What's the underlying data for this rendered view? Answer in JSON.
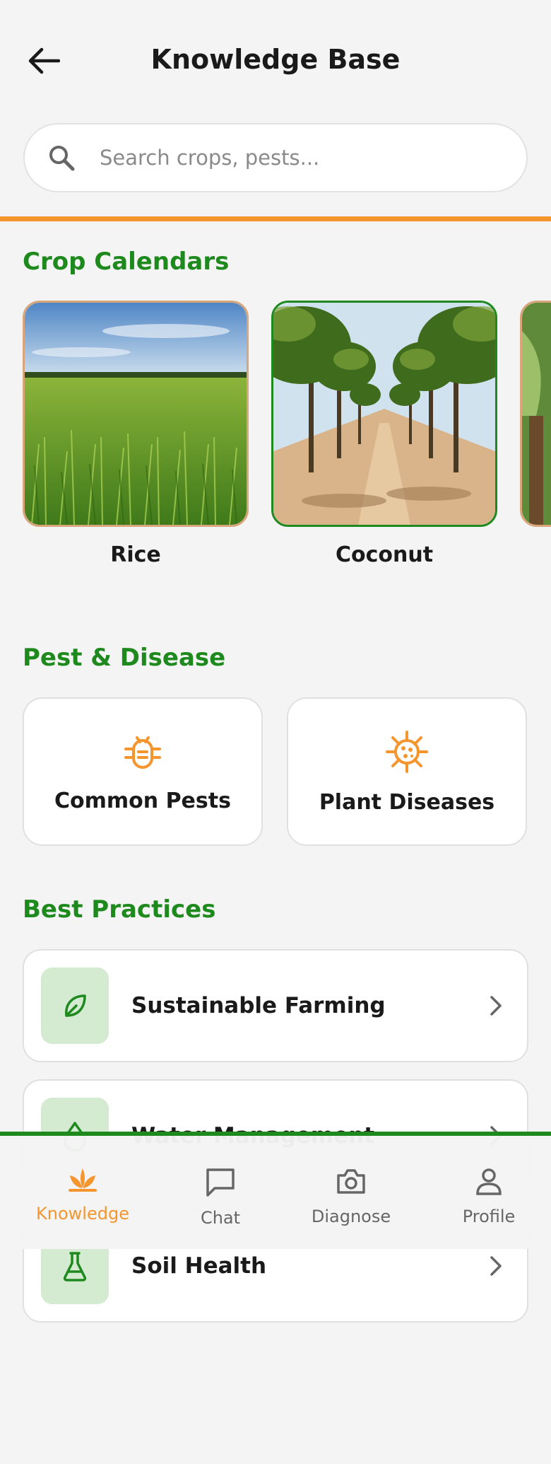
{
  "header": {
    "title": "Knowledge Base"
  },
  "search": {
    "placeholder": "Search crops, pests..."
  },
  "crop_calendars": {
    "title": "Crop Calendars",
    "items": [
      {
        "label": "Rice"
      },
      {
        "label": "Coconut"
      },
      {
        "label": ""
      }
    ]
  },
  "pest_disease": {
    "title": "Pest & Disease",
    "items": [
      {
        "label": "Common Pests",
        "icon": "bug-icon"
      },
      {
        "label": "Plant Diseases",
        "icon": "virus-icon"
      }
    ]
  },
  "best_practices": {
    "title": "Best Practices",
    "items": [
      {
        "label": "Sustainable Farming",
        "icon": "leaf-icon"
      },
      {
        "label": "Water Management",
        "icon": "droplet-icon"
      },
      {
        "label": "Soil Health",
        "icon": "flask-icon"
      }
    ]
  },
  "nav": {
    "items": [
      {
        "label": "Knowledge",
        "icon": "sprout-icon",
        "active": true
      },
      {
        "label": "Chat",
        "icon": "chat-icon",
        "active": false
      },
      {
        "label": "Diagnose",
        "icon": "camera-icon",
        "active": false
      },
      {
        "label": "Profile",
        "icon": "user-icon",
        "active": false
      }
    ]
  },
  "colors": {
    "accent_orange": "#f5952e",
    "brand_green": "#1e8a1e",
    "icon_bg": "#d4ead1"
  }
}
